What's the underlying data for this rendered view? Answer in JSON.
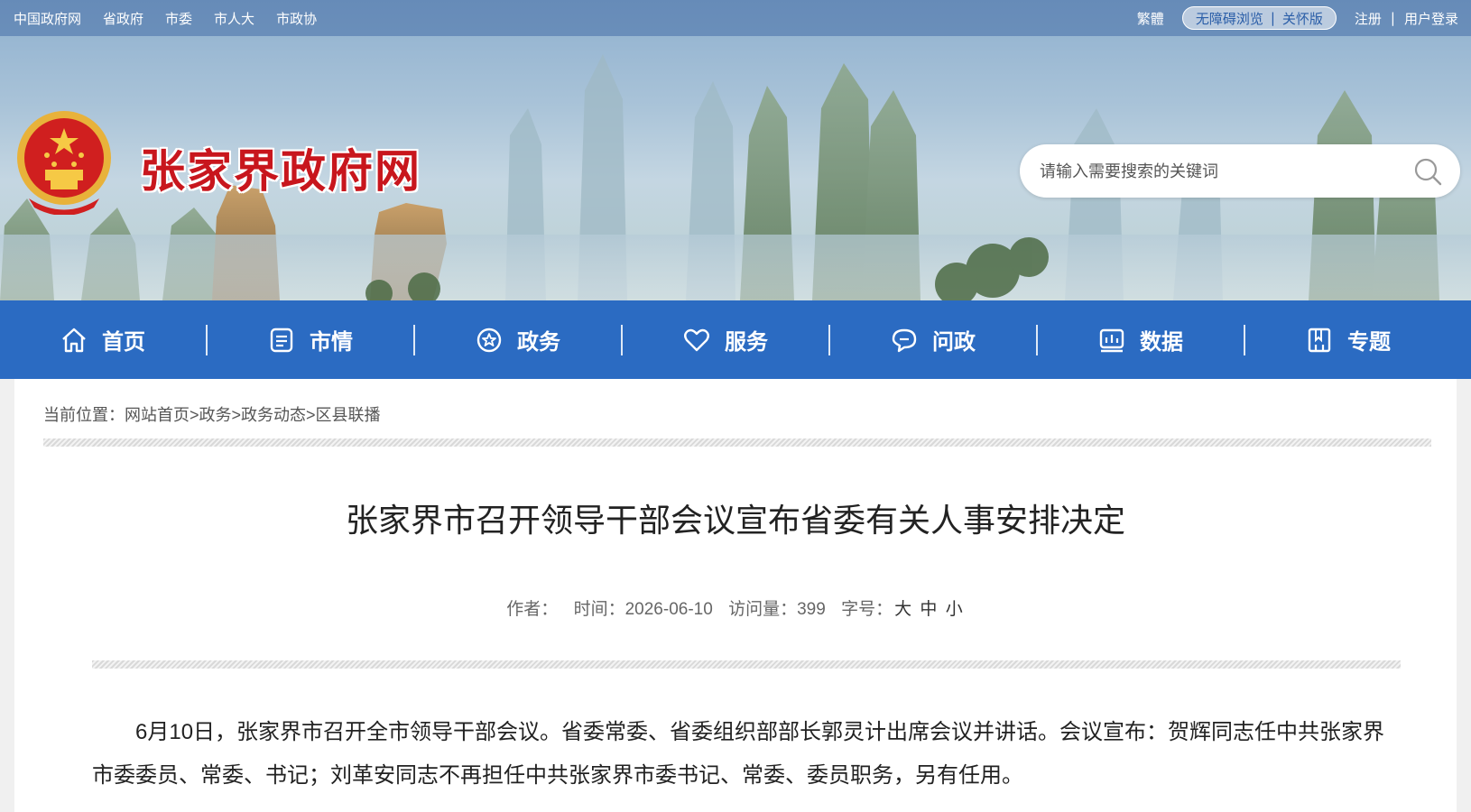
{
  "topbar": {
    "links": [
      "中国政府网",
      "省政府",
      "市委",
      "市人大",
      "市政协"
    ],
    "traditional": "繁體",
    "accessible": "无障碍浏览",
    "care_mode": "关怀版",
    "register": "注册",
    "divider": "|",
    "login": "用户登录"
  },
  "header": {
    "site_title": "张家界政府网",
    "search_placeholder": "请输入需要搜索的关键词"
  },
  "nav": {
    "items": [
      {
        "label": "首页",
        "icon": "home-icon"
      },
      {
        "label": "市情",
        "icon": "document-icon"
      },
      {
        "label": "政务",
        "icon": "badge-icon"
      },
      {
        "label": "服务",
        "icon": "heart-icon"
      },
      {
        "label": "问政",
        "icon": "chat-icon"
      },
      {
        "label": "数据",
        "icon": "chart-icon"
      },
      {
        "label": "专题",
        "icon": "book-icon"
      }
    ]
  },
  "breadcrumb": {
    "prefix": "当前位置：",
    "items": [
      "网站首页",
      "政务",
      "政务动态",
      "区县联播"
    ],
    "separator": ">"
  },
  "article": {
    "title": "张家界市召开领导干部会议宣布省委有关人事安排决定",
    "meta": {
      "author_label": "作者：",
      "time_label": "时间：",
      "time": "2026-06-10",
      "views_label": "访问量：",
      "views": "399",
      "fontsize_label": "字号：",
      "size_large": "大",
      "size_medium": "中",
      "size_small": "小"
    },
    "body": "6月10日，张家界市召开全市领导干部会议。省委常委、省委组织部部长郭灵计出席会议并讲话。会议宣布：贺辉同志任中共张家界市委委员、常委、书记；刘革安同志不再担任中共张家界市委书记、常委、委员职务，另有任用。"
  },
  "colors": {
    "nav_bg": "#2b6bc2",
    "title_red": "#c8161d"
  }
}
